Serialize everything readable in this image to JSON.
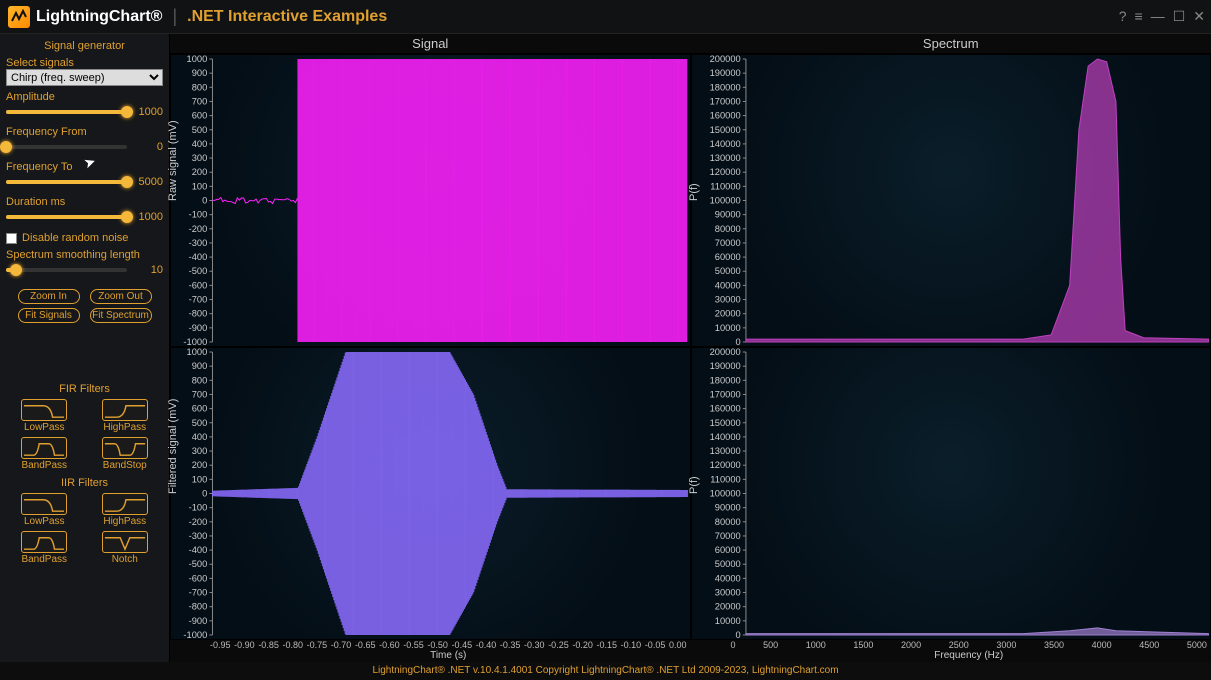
{
  "titlebar": {
    "brand": "LightningChart®",
    "subtitle": ".NET Interactive Examples",
    "help_icon": "?",
    "menu_icon": "≡",
    "min_icon": "—",
    "max_icon": "☐",
    "close_icon": "✕"
  },
  "sidebar": {
    "group": "Signal generator",
    "select_label": "Select signals",
    "select_value": "Chirp (freq. sweep)",
    "amplitude": {
      "label": "Amplitude",
      "value": "1000",
      "pct": 100
    },
    "freqFrom": {
      "label": "Frequency From",
      "value": "0",
      "pct": 0
    },
    "freqTo": {
      "label": "Frequency To",
      "value": "5000",
      "pct": 100
    },
    "duration": {
      "label": "Duration ms",
      "value": "1000",
      "pct": 100
    },
    "noise": {
      "label": "Disable random noise"
    },
    "smooth": {
      "label": "Spectrum smoothing length",
      "value": "10",
      "pct": 8
    },
    "zoom_in": "Zoom In",
    "zoom_out": "Zoom Out",
    "fit_sig": "Fit Signals",
    "fit_spec": "Fit Spectrum",
    "fir_head": "FIR Filters",
    "iir_head": "IIR Filters",
    "filters": {
      "lowpass": "LowPass",
      "highpass": "HighPass",
      "bandpass": "BandPass",
      "bandstop": "BandStop",
      "notch": "Notch"
    }
  },
  "charts": {
    "signal_title": "Signal",
    "spectrum_title": "Spectrum",
    "raw_ylabel": "Raw signal (mV)",
    "filt_ylabel": "Filtered signal (mV)",
    "spec_ylabel": "P(f)",
    "time_xlabel": "Time (s)",
    "freq_xlabel": "Frequency (Hz)",
    "raw_yticks": [
      "1000",
      "900",
      "800",
      "700",
      "600",
      "500",
      "400",
      "300",
      "200",
      "100",
      "0",
      "-100",
      "-200",
      "-300",
      "-400",
      "-500",
      "-600",
      "-700",
      "-800",
      "-900",
      "-1000"
    ],
    "spec_yticks": [
      "200000",
      "190000",
      "180000",
      "170000",
      "160000",
      "150000",
      "140000",
      "130000",
      "120000",
      "110000",
      "100000",
      "90000",
      "80000",
      "70000",
      "60000",
      "50000",
      "40000",
      "30000",
      "20000",
      "10000",
      "0"
    ],
    "time_xticks": [
      "-0.95",
      "-0.90",
      "-0.85",
      "-0.80",
      "-0.75",
      "-0.70",
      "-0.65",
      "-0.60",
      "-0.55",
      "-0.50",
      "-0.45",
      "-0.40",
      "-0.35",
      "-0.30",
      "-0.25",
      "-0.20",
      "-0.15",
      "-0.10",
      "-0.05",
      "0.00"
    ],
    "freq_xticks": [
      "0",
      "500",
      "1000",
      "1500",
      "2000",
      "2500",
      "3000",
      "3500",
      "4000",
      "4500",
      "5000"
    ]
  },
  "chart_data": [
    {
      "type": "line",
      "name": "Raw signal",
      "description": "Chirp sweep, dense oscillation filling range between t≈-0.82 and t≈0.00, amplitude ±1000 mV; near-zero noise before t≈-0.82",
      "x_range": [
        -1.0,
        0.0
      ],
      "y_range": [
        -1000,
        1000
      ],
      "xlabel": "Time (s)",
      "ylabel": "Raw signal (mV)",
      "color": "#ff20ff",
      "envelope_points": [
        [
          -1.0,
          10
        ],
        [
          -0.85,
          15
        ],
        [
          -0.82,
          1000
        ],
        [
          0.0,
          1000
        ]
      ]
    },
    {
      "type": "line",
      "name": "Filtered signal",
      "description": "Band-pass filtered chirp: ramps up from t≈-0.82, amplitude grows to ±1000 by t≈-0.70, sustains to t≈-0.50, decays back to noise by t≈-0.38",
      "x_range": [
        -1.0,
        0.0
      ],
      "y_range": [
        -1000,
        1000
      ],
      "xlabel": "Time (s)",
      "ylabel": "Filtered signal (mV)",
      "color": "#9a78ff",
      "envelope_points": [
        [
          -1.0,
          20
        ],
        [
          -0.82,
          40
        ],
        [
          -0.78,
          400
        ],
        [
          -0.72,
          1000
        ],
        [
          -0.5,
          1000
        ],
        [
          -0.45,
          700
        ],
        [
          -0.4,
          200
        ],
        [
          -0.38,
          30
        ],
        [
          0.0,
          25
        ]
      ]
    },
    {
      "type": "area",
      "name": "Raw spectrum",
      "description": "Narrow peak centred ≈3700–4000 Hz, height ≈200000, baseline ≈2000 elsewhere",
      "x_range": [
        0,
        5000
      ],
      "y_range": [
        0,
        200000
      ],
      "xlabel": "Frequency (Hz)",
      "ylabel": "P(f)",
      "color": "#c040c0",
      "points": [
        [
          0,
          2000
        ],
        [
          3000,
          2000
        ],
        [
          3300,
          5000
        ],
        [
          3500,
          40000
        ],
        [
          3600,
          150000
        ],
        [
          3700,
          195000
        ],
        [
          3800,
          200000
        ],
        [
          3900,
          198000
        ],
        [
          4000,
          170000
        ],
        [
          4050,
          60000
        ],
        [
          4100,
          8000
        ],
        [
          4300,
          3000
        ],
        [
          5000,
          2000
        ]
      ]
    },
    {
      "type": "area",
      "name": "Filtered spectrum",
      "description": "Very low, nearly flat baseline across 0–5000 Hz after filtering; slight rise near 3500–4000 Hz",
      "x_range": [
        0,
        5000
      ],
      "y_range": [
        0,
        200000
      ],
      "xlabel": "Frequency (Hz)",
      "ylabel": "P(f)",
      "color": "#a080d0",
      "points": [
        [
          0,
          1000
        ],
        [
          3000,
          1000
        ],
        [
          3500,
          3000
        ],
        [
          3800,
          5000
        ],
        [
          4000,
          3000
        ],
        [
          5000,
          1000
        ]
      ]
    }
  ],
  "footer": "LightningChart® .NET v.10.4.1.4001 Copyright LightningChart® .NET Ltd 2009-2023, LightningChart.com"
}
